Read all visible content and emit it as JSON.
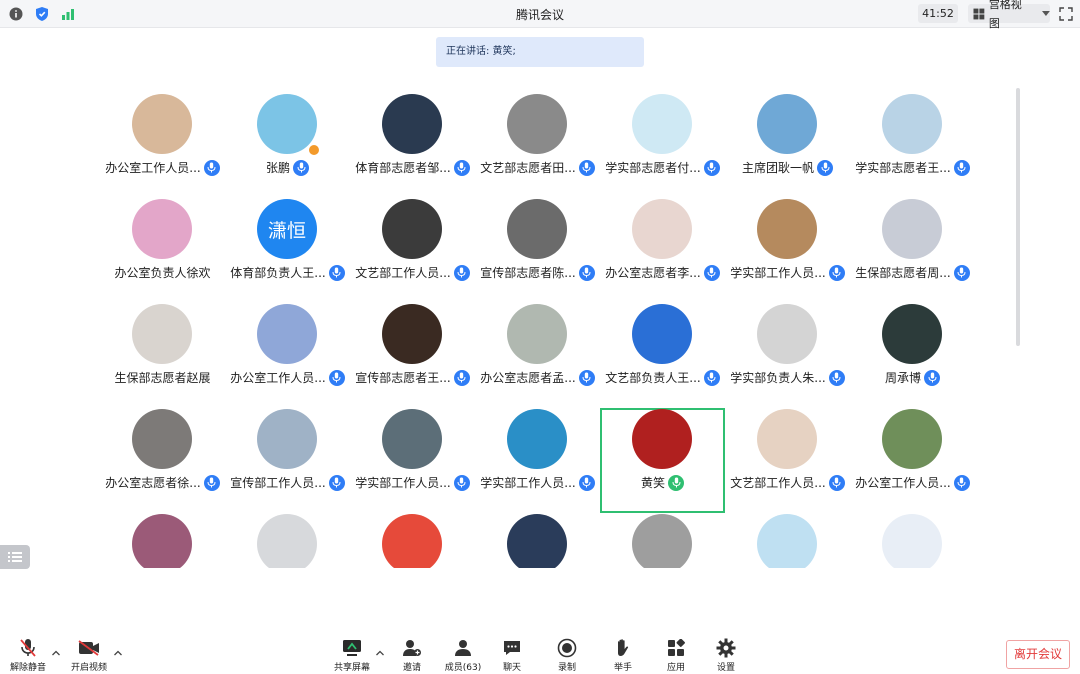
{
  "window": {
    "title": "腾讯会议",
    "timer": "41:52",
    "view_mode": "宫格视图"
  },
  "speaking_banner": "正在讲话: 黄笑;",
  "participants": [
    {
      "name": "办公室工作人员...",
      "mic": "on",
      "avatar_color": "#d8b89a",
      "avatar_text": "",
      "state": ""
    },
    {
      "name": "张鹏",
      "mic": "on",
      "avatar_color": "#7cc4e6",
      "avatar_text": "",
      "state": "host"
    },
    {
      "name": "体育部志愿者邹...",
      "mic": "on",
      "avatar_color": "#2a3a50",
      "avatar_text": "",
      "state": ""
    },
    {
      "name": "文艺部志愿者田...",
      "mic": "on",
      "avatar_color": "#8a8a8a",
      "avatar_text": "",
      "state": ""
    },
    {
      "name": "学实部志愿者付...",
      "mic": "on",
      "avatar_color": "#cfe9f4",
      "avatar_text": "",
      "state": ""
    },
    {
      "name": "主席团耿一帆",
      "mic": "on",
      "avatar_color": "#6fa8d6",
      "avatar_text": "",
      "state": ""
    },
    {
      "name": "学实部志愿者王...",
      "mic": "on",
      "avatar_color": "#b9d3e6",
      "avatar_text": "",
      "state": ""
    },
    {
      "name": "办公室负责人徐欢",
      "mic": "none",
      "avatar_color": "#e3a6c9",
      "avatar_text": "",
      "state": ""
    },
    {
      "name": "体育部负责人王...",
      "mic": "on",
      "avatar_color": "#1f86f0",
      "avatar_text": "潇恒",
      "state": ""
    },
    {
      "name": "文艺部工作人员...",
      "mic": "on",
      "avatar_color": "#3b3b3b",
      "avatar_text": "",
      "state": ""
    },
    {
      "name": "宣传部志愿者陈...",
      "mic": "on",
      "avatar_color": "#6b6b6b",
      "avatar_text": "",
      "state": ""
    },
    {
      "name": "办公室志愿者李...",
      "mic": "on",
      "avatar_color": "#e8d6d0",
      "avatar_text": "",
      "state": ""
    },
    {
      "name": "学实部工作人员...",
      "mic": "on",
      "avatar_color": "#b58a5e",
      "avatar_text": "",
      "state": ""
    },
    {
      "name": "生保部志愿者周...",
      "mic": "on",
      "avatar_color": "#c8ccd6",
      "avatar_text": "",
      "state": ""
    },
    {
      "name": "生保部志愿者赵展",
      "mic": "none",
      "avatar_color": "#d9d4cf",
      "avatar_text": "",
      "state": ""
    },
    {
      "name": "办公室工作人员...",
      "mic": "on",
      "avatar_color": "#8fa7d8",
      "avatar_text": "",
      "state": ""
    },
    {
      "name": "宣传部志愿者王...",
      "mic": "on",
      "avatar_color": "#3a2a22",
      "avatar_text": "",
      "state": ""
    },
    {
      "name": "办公室志愿者孟...",
      "mic": "on",
      "avatar_color": "#b0b8b0",
      "avatar_text": "",
      "state": ""
    },
    {
      "name": "文艺部负责人王...",
      "mic": "on",
      "avatar_color": "#2a6fd6",
      "avatar_text": "",
      "state": ""
    },
    {
      "name": "学实部负责人朱...",
      "mic": "on",
      "avatar_color": "#d4d4d4",
      "avatar_text": "",
      "state": ""
    },
    {
      "name": "周承博",
      "mic": "on",
      "avatar_color": "#2c3b3a",
      "avatar_text": "",
      "state": ""
    },
    {
      "name": "办公室志愿者徐...",
      "mic": "on",
      "avatar_color": "#7d7a78",
      "avatar_text": "",
      "state": ""
    },
    {
      "name": "宣传部工作人员...",
      "mic": "on",
      "avatar_color": "#9fb2c6",
      "avatar_text": "",
      "state": ""
    },
    {
      "name": "学实部工作人员...",
      "mic": "on",
      "avatar_color": "#5c6e78",
      "avatar_text": "",
      "state": ""
    },
    {
      "name": "学实部工作人员...",
      "mic": "on",
      "avatar_color": "#2a8fc7",
      "avatar_text": "",
      "state": ""
    },
    {
      "name": "黄笑",
      "mic": "talking",
      "avatar_color": "#b0201f",
      "avatar_text": "",
      "state": "active"
    },
    {
      "name": "文艺部工作人员...",
      "mic": "on",
      "avatar_color": "#e6d2c2",
      "avatar_text": "",
      "state": ""
    },
    {
      "name": "办公室工作人员...",
      "mic": "on",
      "avatar_color": "#6f8f5a",
      "avatar_text": "",
      "state": ""
    },
    {
      "name": "",
      "mic": "none",
      "avatar_color": "#9b5a78",
      "avatar_text": "",
      "state": ""
    },
    {
      "name": "",
      "mic": "none",
      "avatar_color": "#d7d9dc",
      "avatar_text": "",
      "state": ""
    },
    {
      "name": "",
      "mic": "none",
      "avatar_color": "#e64a3a",
      "avatar_text": "",
      "state": ""
    },
    {
      "name": "",
      "mic": "none",
      "avatar_color": "#2a3c5a",
      "avatar_text": "",
      "state": ""
    },
    {
      "name": "",
      "mic": "none",
      "avatar_color": "#9e9e9e",
      "avatar_text": "",
      "state": ""
    },
    {
      "name": "",
      "mic": "none",
      "avatar_color": "#bfe0f2",
      "avatar_text": "",
      "state": ""
    },
    {
      "name": "",
      "mic": "none",
      "avatar_color": "#e8eef6",
      "avatar_text": "",
      "state": ""
    }
  ],
  "toolbar": {
    "unmute": "解除静音",
    "start_video": "开启视频",
    "share_screen": "共享屏幕",
    "invite": "邀请",
    "members": "成员(63)",
    "chat": "聊天",
    "record": "录制",
    "raise_hand": "举手",
    "apps": "应用",
    "settings": "设置",
    "leave": "离开会议"
  },
  "colors": {
    "accent_blue": "#2f7df6",
    "talking_green": "#2fbf71",
    "leave_red": "#e23a3a"
  }
}
